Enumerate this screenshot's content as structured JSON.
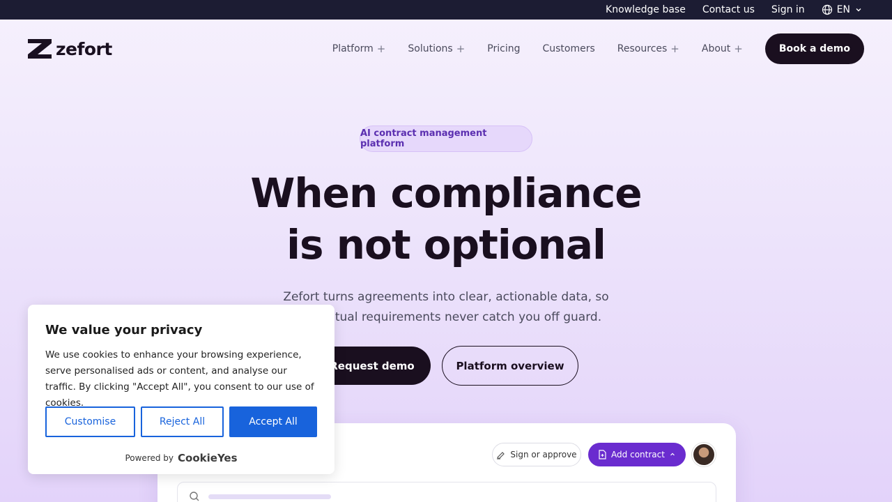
{
  "topbar": {
    "knowledge_base": "Knowledge base",
    "contact_us": "Contact us",
    "sign_in": "Sign in",
    "language": "EN",
    "globe_icon": "globe-icon",
    "chevron_icon": "chevron-down-icon"
  },
  "nav": {
    "logo_text": "zefort",
    "items": [
      {
        "label": "Platform",
        "expandable": true
      },
      {
        "label": "Solutions",
        "expandable": true
      },
      {
        "label": "Pricing",
        "expandable": false
      },
      {
        "label": "Customers",
        "expandable": false
      },
      {
        "label": "Resources",
        "expandable": true
      },
      {
        "label": "About",
        "expandable": true
      }
    ],
    "plus_symbol": "+",
    "cta": "Book a demo"
  },
  "hero": {
    "badge": "AI contract management platform",
    "headline_line1": "When compliance",
    "headline_line2": "is not optional",
    "subtext": "Zefort turns agreements into clear, actionable data, so contractual requirements never catch you off guard.",
    "primary_cta": "Request demo",
    "secondary_cta": "Platform overview"
  },
  "preview": {
    "sign_button": "Sign or approve",
    "add_button": "Add contract"
  },
  "cookie": {
    "title": "We value your privacy",
    "body": "We use cookies to enhance your browsing experience, serve personalised ads or content, and analyse our traffic. By clicking \"Accept All\", you consent to our use of cookies.",
    "customise": "Customise",
    "reject": "Reject All",
    "accept": "Accept All",
    "powered_by": "Powered by",
    "brand": "CookieYes"
  },
  "colors": {
    "topbar_bg": "#1c1c33",
    "dark": "#1a0f1f",
    "accent_purple": "#6a2ccf",
    "cookie_blue": "#1863dc"
  }
}
